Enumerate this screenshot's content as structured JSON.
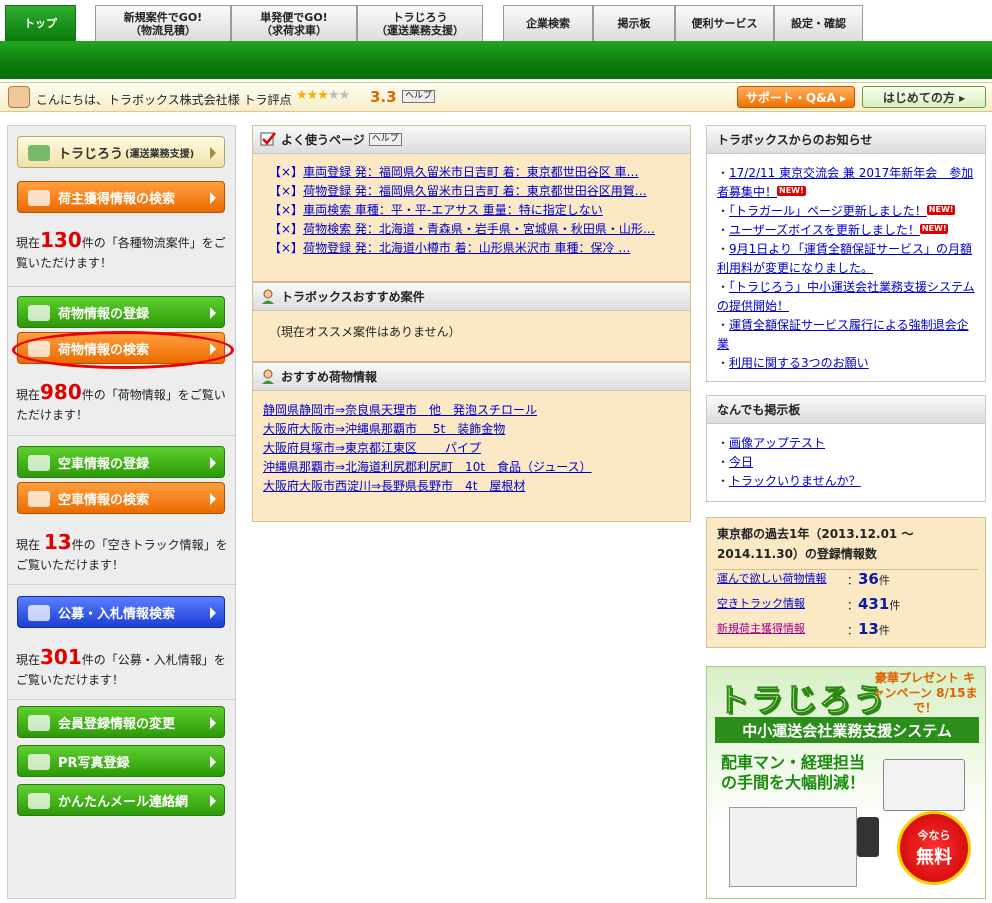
{
  "nav": {
    "tabs": [
      {
        "l1": "トップ",
        "l2": ""
      },
      {
        "l1": "新規案件でGO!",
        "l2": "（物流見積）"
      },
      {
        "l1": "単発便でGO!",
        "l2": "（求荷求車）"
      },
      {
        "l1": "トラじろう",
        "l2": "（運送業務支援）"
      },
      {
        "l1": "企業検索",
        "l2": ""
      },
      {
        "l1": "掲示板",
        "l2": ""
      },
      {
        "l1": "便利サービス",
        "l2": ""
      },
      {
        "l1": "設定・確認",
        "l2": ""
      }
    ]
  },
  "greeting": {
    "text": "こんにちは、トラボックス株式会社様 トラ評点",
    "stars_on": "★★★",
    "stars_off": "★★",
    "score": "3.3",
    "help": "ヘルプ",
    "support": "サポート・Q&A ▸",
    "beginner": "はじめての方 ▸"
  },
  "left": {
    "torajiro_label": "トラじろう",
    "torajiro_sub": "(運送業務支援)",
    "shipper_search": "荷主獲得情報の検索",
    "case_text_pre": "現在",
    "case_count": "130",
    "case_text_post": "件の「各種物流案件」をご覧いただけます！",
    "cargo_register": "荷物情報の登録",
    "cargo_search": "荷物情報の検索",
    "cargo_text_pre": "現在",
    "cargo_count": "980",
    "cargo_text_post": "件の「荷物情報」をご覧いただけます！",
    "truck_register": "空車情報の登録",
    "truck_search": "空車情報の検索",
    "truck_text_pre": "現在 ",
    "truck_count": "13",
    "truck_text_post": "件の「空きトラック情報」をご覧いただけます！",
    "tender_search": "公募・入札情報検索",
    "tender_text_pre": "現在",
    "tender_count": "301",
    "tender_text_post": "件の「公募・入札情報」をご覧いただけます！",
    "member_change": "会員登録情報の変更",
    "pr_photo": "PR写真登録",
    "mail_network": "かんたんメール連絡網"
  },
  "favorites": {
    "title": "よく使うページ",
    "help": "ヘルプ",
    "items": [
      "車両登録 発：福岡県久留米市日吉町 着：東京都世田谷区 車…",
      "荷物登録 発：福岡県久留米市日吉町 着：東京都世田谷区用賀…",
      "車両検索 車種：平・平-エアサス 重量：特に指定しない",
      "荷物検索 発：北海道・青森県・岩手県・宮城県・秋田県・山形…",
      "荷物登録 発：北海道小樽市 着：山形県米沢市 車種：保冷 …"
    ],
    "x": "【×】"
  },
  "recommend": {
    "title": "トラボックスおすすめ案件",
    "empty": "（現在オススメ案件はありません）"
  },
  "cargo_reco": {
    "title": "おすすめ荷物情報",
    "items": [
      "静岡県静岡市⇒奈良県天理市　他　発泡スチロール",
      "大阪府大阪市⇒沖縄県那覇市　 5t　装飾金物",
      "大阪府貝塚市⇒東京都江東区　　 パイプ",
      "沖縄県那覇市⇒北海道利尻郡利尻町　10t　食品（ジュース）",
      "大阪府大阪市西淀川⇒長野県長野市　4t　屋根材"
    ]
  },
  "news": {
    "title": "トラボックスからのお知らせ",
    "items": [
      {
        "text": "17/2/11 東京交流会 兼 2017年新年会　参加者募集中！",
        "new": true
      },
      {
        "text": "「トラガール」ページ更新しました！",
        "new": true
      },
      {
        "text": "ユーザーズボイスを更新しました！",
        "new": true
      },
      {
        "text": "9月1日より「運賃全額保証サービス」の月額利用料が変更になりました。",
        "new": false
      },
      {
        "text": "「トラじろう」中小運送会社業務支援システムの提供開始！",
        "new": false
      },
      {
        "text": "運賃全額保証サービス履行による強制退会企業",
        "new": false
      },
      {
        "text": "利用に関する3つのお願い",
        "new": false
      }
    ],
    "badge": "NEW!"
  },
  "board": {
    "title": "なんでも掲示板",
    "items": [
      "画像アップテスト",
      "今日",
      "トラックいりませんか？"
    ]
  },
  "stats": {
    "title": "東京都の過去1年（2013.12.01 ～ 2014.11.30）の登録情報数",
    "rows": [
      {
        "label": "運んで欲しい荷物情報",
        "value": "36",
        "unit": "件"
      },
      {
        "label": "空きトラック情報",
        "value": "431",
        "unit": "件"
      },
      {
        "label": "新規荷主獲得情報",
        "value": "13",
        "unit": "件"
      }
    ]
  },
  "banner": {
    "title": "トラじろう",
    "campaign": "豪華プレゼント キャンペーン 8/15まで！",
    "bar": "中小運送会社業務支援システム",
    "copy1": "配車マン・経理担当",
    "copy2": "の手間を大幅削減！",
    "cta1": "今なら",
    "cta2": "無料"
  }
}
